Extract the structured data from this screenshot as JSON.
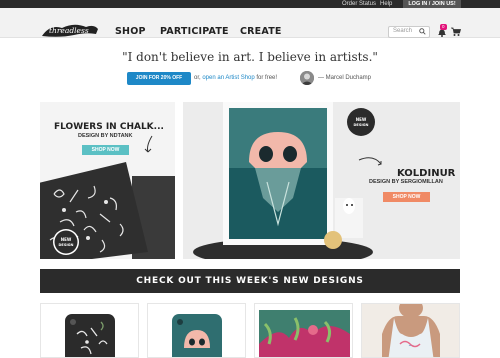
{
  "utility_bar": {
    "order_status": "Order Status",
    "help": "Help",
    "login": "LOG IN / JOIN US!"
  },
  "header": {
    "logo_text": "threadless",
    "nav": [
      "SHOP",
      "PARTICIPATE",
      "CREATE"
    ],
    "search_placeholder": "Search",
    "notification_count": "0"
  },
  "quote": {
    "text": "\"I don't believe in art. I believe in artists.\"",
    "join_button": "JOIN FOR 20% OFF",
    "artist_prefix": "or,",
    "artist_link": "open an Artist Shop",
    "artist_suffix": "for free!",
    "author": "— Marcel Duchamp"
  },
  "promos": [
    {
      "title": "FLOWERS IN CHALK...",
      "subtitle": "DESIGN BY NDTANK",
      "button": "SHOP NOW",
      "button_color": "#5bc0c4"
    },
    {
      "title": "KOLDINUR",
      "subtitle": "DESIGN BY SERGIOMILLAN",
      "button": "SHOP NOW",
      "button_color": "#f08a65"
    }
  ],
  "badges": {
    "new_design": "NEW DESIGN"
  },
  "banner": "CHECK OUT THIS WEEK'S NEW DESIGNS",
  "colors": {
    "accent_blue": "#1e88c7",
    "dark": "#2b2b2b",
    "teal": "#5bc0c4",
    "salmon": "#f08a65",
    "pink_badge": "#e2127a"
  }
}
